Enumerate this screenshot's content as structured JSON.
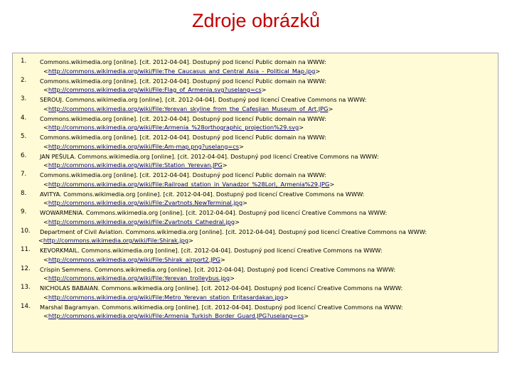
{
  "title": "Zdroje obrázků",
  "refs": [
    {
      "num": "1.",
      "text": "Commons.wikimedia.org [online]. [cit. 2012-04-04]. Dostupný pod licencí Public domain na WWW:",
      "link": "http://commons.wikimedia.org/wiki/File:The_Caucasus_and_Central_Asia_-_Political_Map.jpg"
    },
    {
      "num": "2.",
      "text": "Commons.wikimedia.org [online]. [cit. 2012-04-04]. Dostupný pod licencí Public domain na WWW:",
      "link": "http://commons.wikimedia.org/wiki/File:Flag_of_Armenia.svg?uselang=cs"
    },
    {
      "num": "3.",
      "text": "SEROUJ. Commons.wikimedia.org [online]. [cit. 2012-04-04]. Dostupný pod licencí Creative Commons na WWW:",
      "link": "http://commons.wikimedia.org/wiki/File:Yerevan_skyline_from_the_Cafesjian_Museum_of_Art.JPG"
    },
    {
      "num": "4.",
      "text": "Commons.wikimedia.org [online]. [cit. 2012-04-04]. Dostupný pod licencí Public domain na WWW:",
      "link": "http://commons.wikimedia.org/wiki/File:Armenia_%28orthographic_projection%29.svg"
    },
    {
      "num": "5.",
      "text": "Commons.wikimedia.org [online]. [cit. 2012-04-04]. Dostupný pod licencí Public domain na WWW:",
      "link": "http://commons.wikimedia.org/wiki/File:Am-map.png?uselang=cs"
    },
    {
      "num": "6.",
      "text": "JAN PEŠULA. Commons.wikimedia.org [online]. [cit. 2012-04-04]. Dostupný pod licencí Creative Commons na WWW:",
      "link": "http://commons.wikimedia.org/wiki/File:Station_Yerevan.JPG"
    },
    {
      "num": "7.",
      "text": "Commons.wikimedia.org [online]. [cit. 2012-04-04]. Dostupný pod licencí Public domain na WWW:",
      "link": "http://commons.wikimedia.org/wiki/File:Railroad_station_in_Vanadzor_%28Lori,_Armenia%29.JPG"
    },
    {
      "num": "8.",
      "text": "AVITYA. Commons.wikimedia.org [online]. [cit. 2012-04-04]. Dostupný pod licencí Creative Commons na WWW:",
      "link": "http://commons.wikimedia.org/wiki/File:Zvartnots.NewTerminal.jpg"
    },
    {
      "num": "9.",
      "text": "WOWARMENIA. Commons.wikimedia.org [online]. [cit. 2012-04-04]. Dostupný pod licencí Creative Commons na WWW:",
      "link": "http://commons.wikimedia.org/wiki/File:Zvartnots_Cathedral.jpg"
    },
    {
      "num": "10.",
      "text": "Department of Civil Aviation. Commons.wikimedia.org [online]. [cit. 2012-04-04]. Dostupný pod licencí Creative Commons na WWW:",
      "link": "http://commons.wikimedia.org/wiki/File:Shirak.jpg"
    },
    {
      "num": "11.",
      "text": "KEVORKMAIL. Commons.wikimedia.org [online]. [cit. 2012-04-04]. Dostupný pod licencí Creative Commons na WWW:",
      "link": "http://commons.wikimedia.org/wiki/File:Shirak_airport2.JPG"
    },
    {
      "num": "12.",
      "text": "Crispin Semmens. Commons.wikimedia.org [online]. [cit. 2012-04-04]. Dostupný pod licencí Creative Commons na WWW:",
      "link": "http://commons.wikimedia.org/wiki/File:Yerevan_trolleybus.jpg"
    },
    {
      "num": "13.",
      "text": "NICHOLAS BABAIAN. Commons.wikimedia.org [online]. [cit. 2012-04-04]. Dostupný pod licencí Creative Commons na WWW:",
      "link": "http://commons.wikimedia.org/wiki/File:Metro_Yerevan_station_Eritasardakan.jpg"
    },
    {
      "num": "14.",
      "text": "Marshal Bagramyan. Commons.wikimedia.org [online]. [cit. 2012-04-04]. Dostupný pod licencí Creative Commons na WWW:",
      "link": "http://commons.wikimedia.org/wiki/File:Armenia_Turkish_Border_Guard.JPG?uselang=cs"
    }
  ],
  "colors": {
    "title": "#c00000",
    "box_bg": "#fffbd6",
    "link": "#000080"
  }
}
